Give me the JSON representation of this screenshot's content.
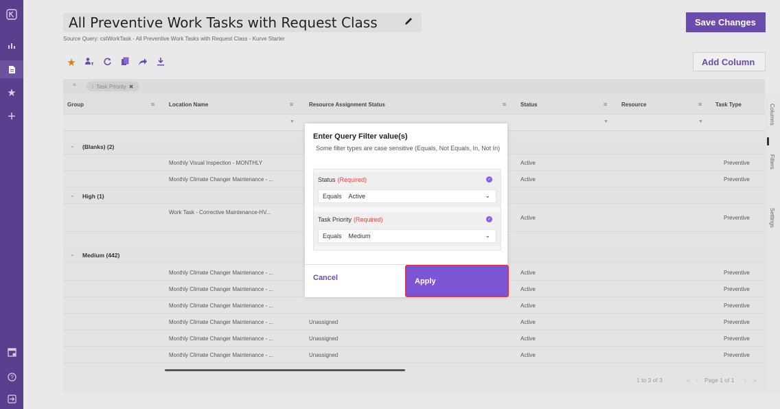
{
  "sidebar": {
    "items": [
      {
        "icon": "logo-icon",
        "glyph": "⨂"
      },
      {
        "icon": "analytics-icon",
        "glyph": "ıl"
      },
      {
        "icon": "document-icon",
        "glyph": "▆"
      },
      {
        "icon": "star-icon",
        "glyph": "★"
      },
      {
        "icon": "plus-icon",
        "glyph": "+"
      }
    ],
    "bottom": [
      {
        "icon": "report-icon",
        "glyph": "▦"
      },
      {
        "icon": "help-icon",
        "glyph": "?"
      },
      {
        "icon": "logout-icon",
        "glyph": "⇥"
      }
    ]
  },
  "header": {
    "title": "All Preventive Work Tasks with Request Class",
    "subtitle": "Source Query: cstWorkTask - All Preventive Work Tasks with Request Class - Kurve Starter",
    "save_label": "Save Changes",
    "add_column_label": "Add Column"
  },
  "toolbar": {
    "icons": [
      "favorite-star-icon",
      "group-users-icon",
      "refresh-icon",
      "copy-icon",
      "share-icon",
      "download-icon"
    ]
  },
  "group_panel": {
    "chip_label": "Task Priority"
  },
  "grid": {
    "columns": [
      "Group",
      "Location Name",
      "Resource Assignment Status",
      "Status",
      "Resource",
      "Task Type"
    ],
    "rows": [
      {
        "type": "group",
        "label": "(Blanks) (2)"
      },
      {
        "type": "data",
        "location": "Monthly Visual Inspection - MONTHLY",
        "assignment": "",
        "status": "Active",
        "resource": "",
        "task_type": "Preventive"
      },
      {
        "type": "data",
        "location": "Monthly Climate Changer Maintenance - ...",
        "assignment": "",
        "status": "Active",
        "resource": "",
        "task_type": "Preventive"
      },
      {
        "type": "group",
        "label": "High (1)"
      },
      {
        "type": "data",
        "location": "Work Task - Corrective Maintenance-HV...",
        "assignment": "",
        "status": "Active",
        "resource": "",
        "task_type": "Preventive"
      },
      {
        "type": "group",
        "label": "Medium (442)"
      },
      {
        "type": "data",
        "location": "Monthly Climate Changer Maintenance - ...",
        "assignment": "",
        "status": "Active",
        "resource": "",
        "task_type": "Preventive"
      },
      {
        "type": "data",
        "location": "Monthly Climate Changer Maintenance - ...",
        "assignment": "",
        "status": "Active",
        "resource": "",
        "task_type": "Preventive"
      },
      {
        "type": "data",
        "location": "Monthly Climate Changer Maintenance - ...",
        "assignment": "",
        "status": "Active",
        "resource": "",
        "task_type": "Preventive"
      },
      {
        "type": "data",
        "location": "Monthly Climate Changer Maintenance - ...",
        "assignment": "Unassigned",
        "status": "Active",
        "resource": "",
        "task_type": "Preventive"
      },
      {
        "type": "data",
        "location": "Monthly Climate Changer Maintenance - ...",
        "assignment": "Unassigned",
        "status": "Active",
        "resource": "",
        "task_type": "Preventive"
      },
      {
        "type": "data",
        "location": "Monthly Climate Changer Maintenance - ...",
        "assignment": "Unassigned",
        "status": "Active",
        "resource": "",
        "task_type": "Preventive"
      }
    ],
    "paging": {
      "range": "1 to 3 of 3",
      "page": "Page 1 of 1"
    }
  },
  "side_panel": {
    "tabs": [
      "Columns",
      "Filters",
      "Settings"
    ]
  },
  "modal": {
    "title": "Enter Query Filter value(s)",
    "description": "Some filter types are case sensitive (Equals, Not Equals, In, Not In)",
    "filters": [
      {
        "field": "Status",
        "required": "(Required)",
        "operator": "Equals",
        "value": "Active"
      },
      {
        "field": "Task Priority",
        "required": "(Required)",
        "operator": "Equals",
        "value": "Medium"
      }
    ],
    "cancel_label": "Cancel",
    "apply_label": "Apply"
  },
  "colors": {
    "brand_purple": "#6a4cad",
    "sidebar": "#5b3f8f",
    "favorite": "#e07b15",
    "required": "#e64545",
    "highlight_border": "#d9363e"
  }
}
